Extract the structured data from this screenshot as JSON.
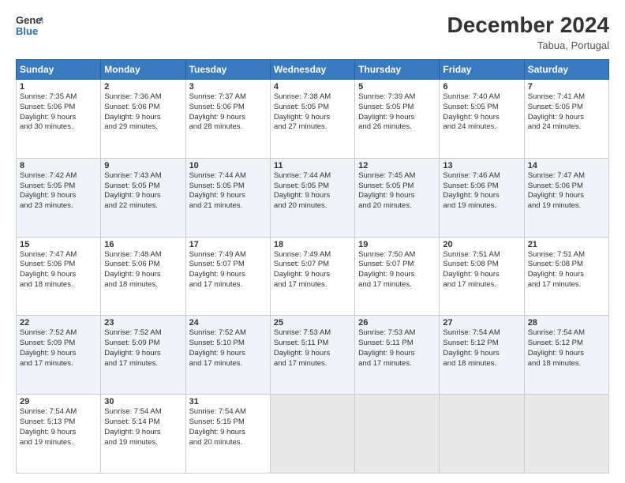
{
  "logo": {
    "line1": "General",
    "line2": "Blue"
  },
  "title": "December 2024",
  "location": "Tabua, Portugal",
  "headers": [
    "Sunday",
    "Monday",
    "Tuesday",
    "Wednesday",
    "Thursday",
    "Friday",
    "Saturday"
  ],
  "weeks": [
    [
      {
        "day": "1",
        "info": "Sunrise: 7:35 AM\nSunset: 5:06 PM\nDaylight: 9 hours\nand 30 minutes."
      },
      {
        "day": "2",
        "info": "Sunrise: 7:36 AM\nSunset: 5:06 PM\nDaylight: 9 hours\nand 29 minutes."
      },
      {
        "day": "3",
        "info": "Sunrise: 7:37 AM\nSunset: 5:06 PM\nDaylight: 9 hours\nand 28 minutes."
      },
      {
        "day": "4",
        "info": "Sunrise: 7:38 AM\nSunset: 5:05 PM\nDaylight: 9 hours\nand 27 minutes."
      },
      {
        "day": "5",
        "info": "Sunrise: 7:39 AM\nSunset: 5:05 PM\nDaylight: 9 hours\nand 26 minutes."
      },
      {
        "day": "6",
        "info": "Sunrise: 7:40 AM\nSunset: 5:05 PM\nDaylight: 9 hours\nand 24 minutes."
      },
      {
        "day": "7",
        "info": "Sunrise: 7:41 AM\nSunset: 5:05 PM\nDaylight: 9 hours\nand 24 minutes."
      }
    ],
    [
      {
        "day": "8",
        "info": "Sunrise: 7:42 AM\nSunset: 5:05 PM\nDaylight: 9 hours\nand 23 minutes."
      },
      {
        "day": "9",
        "info": "Sunrise: 7:43 AM\nSunset: 5:05 PM\nDaylight: 9 hours\nand 22 minutes."
      },
      {
        "day": "10",
        "info": "Sunrise: 7:44 AM\nSunset: 5:05 PM\nDaylight: 9 hours\nand 21 minutes."
      },
      {
        "day": "11",
        "info": "Sunrise: 7:44 AM\nSunset: 5:05 PM\nDaylight: 9 hours\nand 20 minutes."
      },
      {
        "day": "12",
        "info": "Sunrise: 7:45 AM\nSunset: 5:05 PM\nDaylight: 9 hours\nand 20 minutes."
      },
      {
        "day": "13",
        "info": "Sunrise: 7:46 AM\nSunset: 5:06 PM\nDaylight: 9 hours\nand 19 minutes."
      },
      {
        "day": "14",
        "info": "Sunrise: 7:47 AM\nSunset: 5:06 PM\nDaylight: 9 hours\nand 19 minutes."
      }
    ],
    [
      {
        "day": "15",
        "info": "Sunrise: 7:47 AM\nSunset: 5:06 PM\nDaylight: 9 hours\nand 18 minutes."
      },
      {
        "day": "16",
        "info": "Sunrise: 7:48 AM\nSunset: 5:06 PM\nDaylight: 9 hours\nand 18 minutes."
      },
      {
        "day": "17",
        "info": "Sunrise: 7:49 AM\nSunset: 5:07 PM\nDaylight: 9 hours\nand 17 minutes."
      },
      {
        "day": "18",
        "info": "Sunrise: 7:49 AM\nSunset: 5:07 PM\nDaylight: 9 hours\nand 17 minutes."
      },
      {
        "day": "19",
        "info": "Sunrise: 7:50 AM\nSunset: 5:07 PM\nDaylight: 9 hours\nand 17 minutes."
      },
      {
        "day": "20",
        "info": "Sunrise: 7:51 AM\nSunset: 5:08 PM\nDaylight: 9 hours\nand 17 minutes."
      },
      {
        "day": "21",
        "info": "Sunrise: 7:51 AM\nSunset: 5:08 PM\nDaylight: 9 hours\nand 17 minutes."
      }
    ],
    [
      {
        "day": "22",
        "info": "Sunrise: 7:52 AM\nSunset: 5:09 PM\nDaylight: 9 hours\nand 17 minutes."
      },
      {
        "day": "23",
        "info": "Sunrise: 7:52 AM\nSunset: 5:09 PM\nDaylight: 9 hours\nand 17 minutes."
      },
      {
        "day": "24",
        "info": "Sunrise: 7:52 AM\nSunset: 5:10 PM\nDaylight: 9 hours\nand 17 minutes."
      },
      {
        "day": "25",
        "info": "Sunrise: 7:53 AM\nSunset: 5:11 PM\nDaylight: 9 hours\nand 17 minutes."
      },
      {
        "day": "26",
        "info": "Sunrise: 7:53 AM\nSunset: 5:11 PM\nDaylight: 9 hours\nand 17 minutes."
      },
      {
        "day": "27",
        "info": "Sunrise: 7:54 AM\nSunset: 5:12 PM\nDaylight: 9 hours\nand 18 minutes."
      },
      {
        "day": "28",
        "info": "Sunrise: 7:54 AM\nSunset: 5:12 PM\nDaylight: 9 hours\nand 18 minutes."
      }
    ],
    [
      {
        "day": "29",
        "info": "Sunrise: 7:54 AM\nSunset: 5:13 PM\nDaylight: 9 hours\nand 19 minutes."
      },
      {
        "day": "30",
        "info": "Sunrise: 7:54 AM\nSunset: 5:14 PM\nDaylight: 9 hours\nand 19 minutes."
      },
      {
        "day": "31",
        "info": "Sunrise: 7:54 AM\nSunset: 5:15 PM\nDaylight: 9 hours\nand 20 minutes."
      },
      {
        "day": "",
        "info": ""
      },
      {
        "day": "",
        "info": ""
      },
      {
        "day": "",
        "info": ""
      },
      {
        "day": "",
        "info": ""
      }
    ]
  ]
}
